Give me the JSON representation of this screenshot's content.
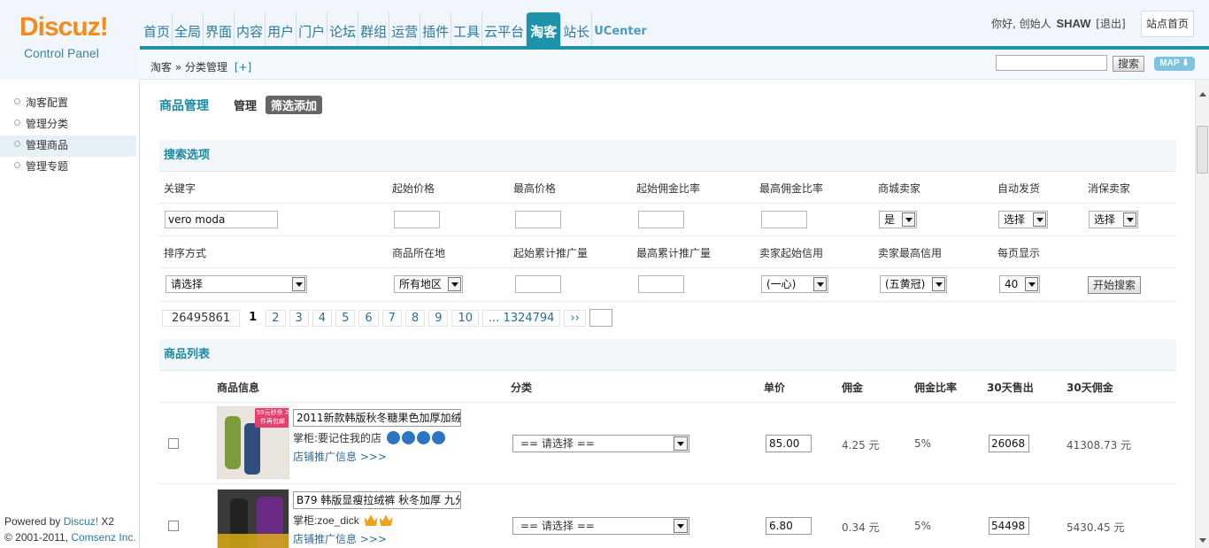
{
  "logo": {
    "brand": "Discuz!",
    "sub": "Control Panel"
  },
  "nav": [
    "首页",
    "全局",
    "界面",
    "内容",
    "用户",
    "门户",
    "论坛",
    "群组",
    "运营",
    "插件",
    "工具",
    "云平台",
    "淘客",
    "站长",
    "UCenter"
  ],
  "user": {
    "greeting": "你好, 创始人",
    "name": "SHAW",
    "logout": "[退出]",
    "site_home": "站点首页"
  },
  "breadcrumb": {
    "path": "淘客 » 分类管理",
    "add": "[+]"
  },
  "search": {
    "button": "搜索",
    "map": "MAP ⬇"
  },
  "sidebar": [
    "淘客配置",
    "管理分类",
    "管理商品",
    "管理专题"
  ],
  "powered": {
    "line1_prefix": "Powered by ",
    "line1_link": "Discuz!",
    "line1_suffix": " X2",
    "line2_prefix": "© 2001-2011, ",
    "line2_link": "Comsenz Inc."
  },
  "tabs": {
    "title": "商品管理",
    "manage": "管理",
    "filter_add": "筛选添加"
  },
  "search_options": {
    "header": "搜索选项",
    "labels1": [
      "关键字",
      "起始价格",
      "最高价格",
      "起始佣金比率",
      "最高佣金比率",
      "商城卖家",
      "自动发货",
      "消保卖家"
    ],
    "keyword": "vero moda",
    "mall_seller": "是",
    "auto_ship": "选择",
    "consumer_protect": "选择",
    "labels2": [
      "排序方式",
      "商品所在地",
      "起始累计推广量",
      "最高累计推广量",
      "卖家起始信用",
      "卖家最高信用",
      "每页显示"
    ],
    "sort": "请选择",
    "location": "所有地区",
    "credit_min": "(一心)",
    "credit_max": "(五黄冠)",
    "per_page": "40",
    "start_button": "开始搜索"
  },
  "pager": {
    "total": "26495861",
    "current": "1",
    "pages": [
      "2",
      "3",
      "4",
      "5",
      "6",
      "7",
      "8",
      "9",
      "10"
    ],
    "last": "... 1324794",
    "next": "››"
  },
  "list": {
    "header": "商品列表",
    "columns": [
      "商品信息",
      "分类",
      "单价",
      "佣金",
      "佣金比率",
      "30天售出",
      "30天佣金"
    ],
    "items": [
      {
        "title": "2011新款韩版秋冬糖果色加厚加绒",
        "shop": "掌柜:要记住我的店",
        "link": "店铺推广信息 >>>",
        "category": "== 请选择 ==",
        "price": "85.00",
        "commission": "4.25 元",
        "rate": "5%",
        "sold": "26068",
        "sold_commission": "41308.73 元",
        "badge": "59元秒杀 2件再包邮"
      },
      {
        "title": "B79 韩版显瘦拉绒裤 秋冬加厚 九分",
        "shop": "掌柜:zoe_dick",
        "link": "店铺推广信息 >>>",
        "category": "== 请选择 ==",
        "price": "6.80",
        "commission": "0.34 元",
        "rate": "5%",
        "sold": "54498",
        "sold_commission": "5430.45 元"
      }
    ]
  }
}
